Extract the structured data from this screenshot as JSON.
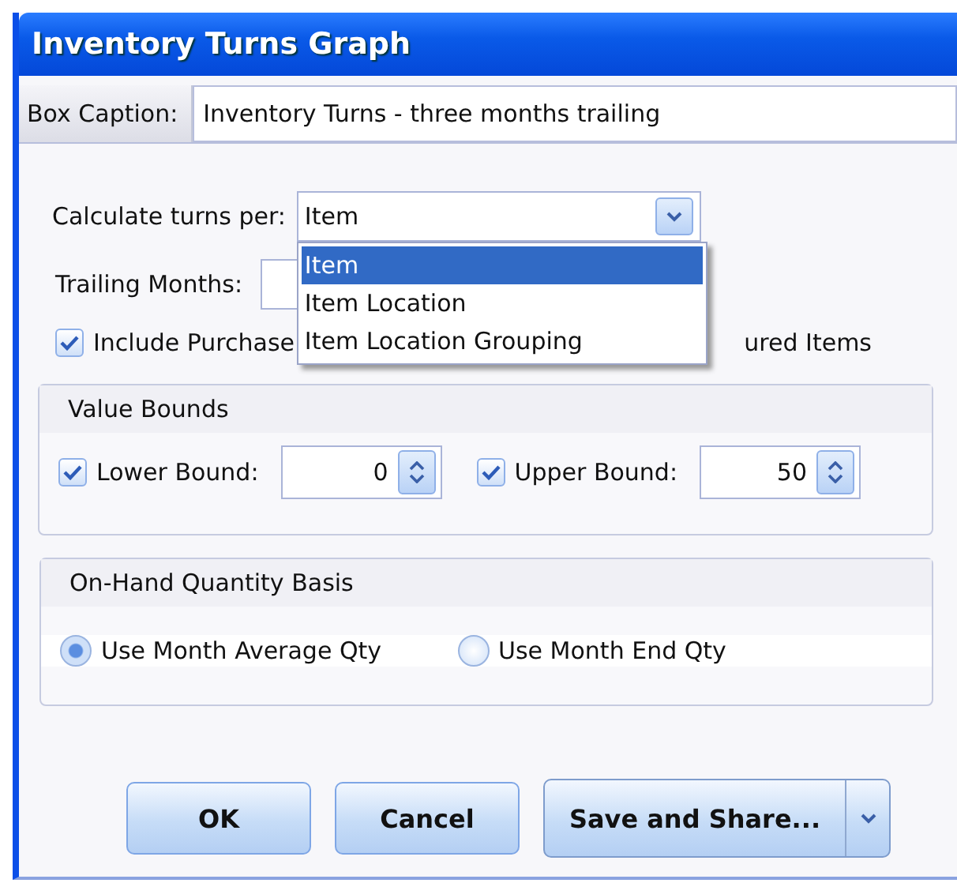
{
  "window": {
    "title": "Inventory Turns Graph"
  },
  "box_caption": {
    "label": "Box Caption:",
    "value": "Inventory Turns - three months trailing"
  },
  "calculate_turns": {
    "label": "Calculate turns per:",
    "value": "Item",
    "expanded": true,
    "options": [
      {
        "label": "Item",
        "selected": true
      },
      {
        "label": "Item Location",
        "selected": false
      },
      {
        "label": "Item Location Grouping",
        "selected": false
      }
    ]
  },
  "trailing_months": {
    "label": "Trailing Months:"
  },
  "include_checkbox": {
    "checked": true,
    "label_start": "Include Purchase",
    "label_end": "ured Items"
  },
  "value_bounds": {
    "title": "Value Bounds",
    "bounds": [
      {
        "label": "Lower Bound:",
        "checked": true,
        "value": "0"
      },
      {
        "label": "Upper Bound:",
        "checked": true,
        "value": "50"
      }
    ]
  },
  "quantity_basis": {
    "title": "On-Hand Quantity Basis",
    "options": [
      {
        "label": "Use Month Average Qty",
        "selected": true
      },
      {
        "label": "Use Month End Qty",
        "selected": false
      }
    ]
  },
  "buttons": [
    {
      "label": "OK",
      "kind": "plain"
    },
    {
      "label": "Cancel",
      "kind": "plain"
    },
    {
      "label": "Save and Share...",
      "kind": "split"
    }
  ]
}
